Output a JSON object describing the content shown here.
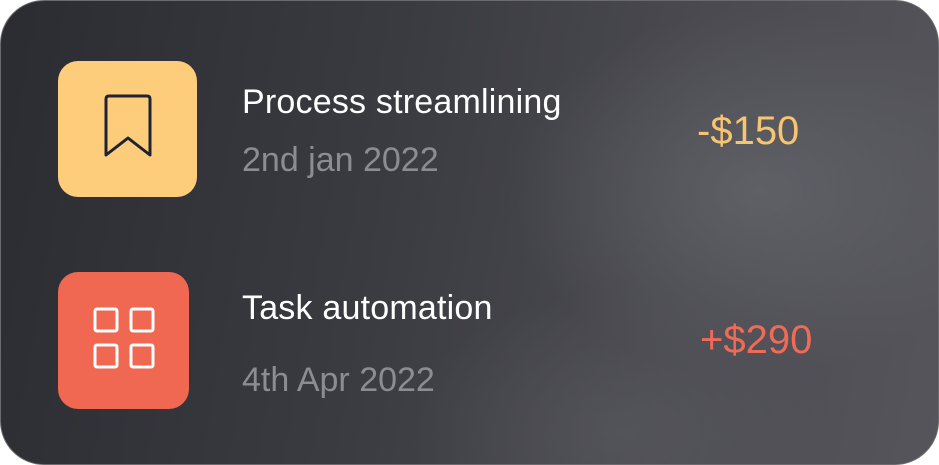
{
  "transactions": [
    {
      "title": "Process streamlining",
      "date": "2nd jan 2022",
      "amount": "-$150",
      "icon": "bookmark-icon",
      "tile_color": "#fdcd7b",
      "amount_color": "#f7c471"
    },
    {
      "title": "Task automation",
      "date": "4th Apr 2022",
      "amount": "+$290",
      "icon": "grid-icon",
      "tile_color": "#f06752",
      "amount_color": "#f06b57"
    }
  ]
}
